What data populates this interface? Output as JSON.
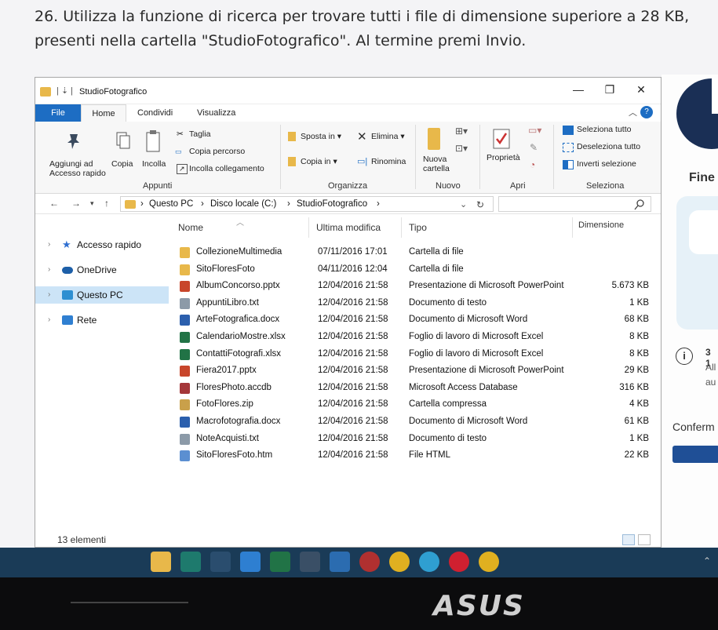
{
  "question": "26. Utilizza la funzione di ricerca per trovare tutti i file di dimensione superiore a 28 KB, presenti nella cartella \"StudioFotografico\". Al termine premi Invio.",
  "window": {
    "title": "StudioFotografico",
    "minimize": "—",
    "maximize": "❐",
    "close": "✕"
  },
  "tabs": [
    "File",
    "Home",
    "Condividi",
    "Visualizza"
  ],
  "ribbon": {
    "pin": "Aggiungi ad\nAccesso rapido",
    "copy": "Copia",
    "paste": "Incolla",
    "cut": "Taglia",
    "copy_path": "Copia percorso",
    "paste_link": "Incolla collegamento",
    "move_to": "Sposta in ▾",
    "copy_to": "Copia in ▾",
    "delete": "Elimina ▾",
    "rename": "Rinomina",
    "new_folder": "Nuova\ncartella",
    "properties": "Proprietà",
    "select_all": "Seleziona tutto",
    "select_none": "Deseleziona tutto",
    "invert": "Inverti selezione",
    "groups": {
      "appunti": "Appunti",
      "organizza": "Organizza",
      "nuovo": "Nuovo",
      "apri": "Apri",
      "seleziona": "Seleziona"
    }
  },
  "address": {
    "crumbs": [
      "Questo PC",
      "Disco locale (C:)",
      "StudioFotografico"
    ]
  },
  "nav": [
    {
      "label": "Accesso rapido",
      "icon": "star-icon",
      "color": "#2f6fd1"
    },
    {
      "label": "OneDrive",
      "icon": "cloud-icon",
      "color": "#1d5fa8"
    },
    {
      "label": "Questo PC",
      "icon": "computer-icon",
      "color": "#2f8fd1"
    },
    {
      "label": "Rete",
      "icon": "network-icon",
      "color": "#2f7fd1"
    }
  ],
  "columns": {
    "name": "Nome",
    "date": "Ultima modifica",
    "type": "Tipo",
    "size": "Dimensione"
  },
  "files": [
    {
      "name": "CollezioneMultimedia",
      "date": "07/11/2016 17:01",
      "type": "Cartella di file",
      "size": "",
      "color": "#e8b84a"
    },
    {
      "name": "SitoFloresFoto",
      "date": "04/11/2016 12:04",
      "type": "Cartella di file",
      "size": "",
      "color": "#e8b84a"
    },
    {
      "name": "AlbumConcorso.pptx",
      "date": "12/04/2016 21:58",
      "type": "Presentazione di Microsoft PowerPoint",
      "size": "5.673 KB",
      "color": "#c8462b"
    },
    {
      "name": "AppuntiLibro.txt",
      "date": "12/04/2016 21:58",
      "type": "Documento di testo",
      "size": "1 KB",
      "color": "#8c9aa8"
    },
    {
      "name": "ArteFotografica.docx",
      "date": "12/04/2016 21:58",
      "type": "Documento di Microsoft Word",
      "size": "68 KB",
      "color": "#2b5fad"
    },
    {
      "name": "CalendarioMostre.xlsx",
      "date": "12/04/2016 21:58",
      "type": "Foglio di lavoro di Microsoft Excel",
      "size": "8 KB",
      "color": "#217346"
    },
    {
      "name": "ContattiFotografi.xlsx",
      "date": "12/04/2016 21:58",
      "type": "Foglio di lavoro di Microsoft Excel",
      "size": "8 KB",
      "color": "#217346"
    },
    {
      "name": "Fiera2017.pptx",
      "date": "12/04/2016 21:58",
      "type": "Presentazione di Microsoft PowerPoint",
      "size": "29 KB",
      "color": "#c8462b"
    },
    {
      "name": "FloresPhoto.accdb",
      "date": "12/04/2016 21:58",
      "type": "Microsoft Access Database",
      "size": "316 KB",
      "color": "#a4373a"
    },
    {
      "name": "FotoFlores.zip",
      "date": "12/04/2016 21:58",
      "type": "Cartella compressa",
      "size": "4 KB",
      "color": "#c9a04a"
    },
    {
      "name": "Macrofotografia.docx",
      "date": "12/04/2016 21:58",
      "type": "Documento di Microsoft Word",
      "size": "61 KB",
      "color": "#2b5fad"
    },
    {
      "name": "NoteAcquisti.txt",
      "date": "12/04/2016 21:58",
      "type": "Documento di testo",
      "size": "1 KB",
      "color": "#8c9aa8"
    },
    {
      "name": "SitoFloresFoto.htm",
      "date": "12/04/2016 21:58",
      "type": "File HTML",
      "size": "22 KB",
      "color": "#5b8fd1"
    }
  ],
  "status": "13 elementi",
  "side": {
    "fine": "Fine",
    "info_title": "3 1",
    "info_line1": "All",
    "info_line2": "au",
    "confirm": "Conferm"
  },
  "taskbar": [
    {
      "name": "file-explorer-icon",
      "color": "#e8b84a"
    },
    {
      "name": "publisher-icon",
      "color": "#1e7a6d"
    },
    {
      "name": "tia-portal-icon",
      "color": "#2a4d6e"
    },
    {
      "name": "teamviewer-icon",
      "color": "#2e7fd1"
    },
    {
      "name": "excel-icon",
      "color": "#217346"
    },
    {
      "name": "calculator-icon",
      "color": "#3a4f66"
    },
    {
      "name": "store-icon",
      "color": "#2b6cb0"
    },
    {
      "name": "nero-icon",
      "color": "#b03030"
    },
    {
      "name": "chrome-icon",
      "color": "#e0b020"
    },
    {
      "name": "edge-icon",
      "color": "#2f9fd1"
    },
    {
      "name": "opera-icon",
      "color": "#d02030"
    },
    {
      "name": "chrome-active-icon",
      "color": "#e0b020"
    }
  ],
  "brand": "ASUS"
}
